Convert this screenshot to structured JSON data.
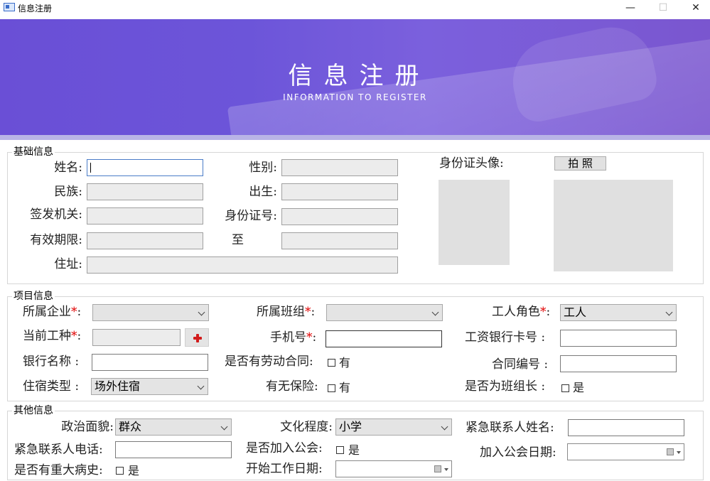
{
  "window": {
    "title": "信息注册",
    "minimize": "—",
    "maximize": "☐",
    "close": "✕"
  },
  "banner": {
    "title": "信息注册",
    "subtitle": "INFORMATION TO REGISTER"
  },
  "basic": {
    "legend": "基础信息",
    "name_label": "姓名:",
    "gender_label": "性别:",
    "ethnicity_label": "民族:",
    "birth_label": "出生:",
    "issuer_label": "签发机关:",
    "id_number_label": "身份证号:",
    "validity_label": "有效期限:",
    "validity_to": "至",
    "address_label": "住址:",
    "id_photo_label": "身份证头像:",
    "capture_button": "拍 照"
  },
  "project": {
    "legend": "项目信息",
    "enterprise_label": "所属企业",
    "team_label": "所属班组",
    "role_label": "工人角色",
    "role_value": "工人",
    "trade_label": "当前工种",
    "phone_label": "手机号",
    "bank_card_label": "工资银行卡号  :",
    "bank_name_label": "银行名称  :",
    "labor_contract_label": "是否有劳动合同:",
    "labor_contract_option": "有",
    "contract_no_label": "合同编号  :",
    "lodging_label": "住宿类型  :",
    "lodging_value": "场外住宿",
    "insurance_label": "有无保险:",
    "insurance_option": "有",
    "team_leader_label": "是否为班组长  :",
    "team_leader_option": "是",
    "required_mark": "*",
    "colon": ":"
  },
  "other": {
    "legend": "其他信息",
    "political_label": "政治面貌:",
    "political_value": "群众",
    "education_label": "文化程度:",
    "education_value": "小学",
    "emergency_name_label": "紧急联系人姓名:",
    "emergency_phone_label": "紧急联系人电话:",
    "union_label": "是否加入公会:",
    "union_option": "是",
    "union_date_label": "加入公会日期:",
    "illness_label": "是否有重大病史:",
    "illness_option": "是",
    "start_date_label": "开始工作日期:"
  }
}
